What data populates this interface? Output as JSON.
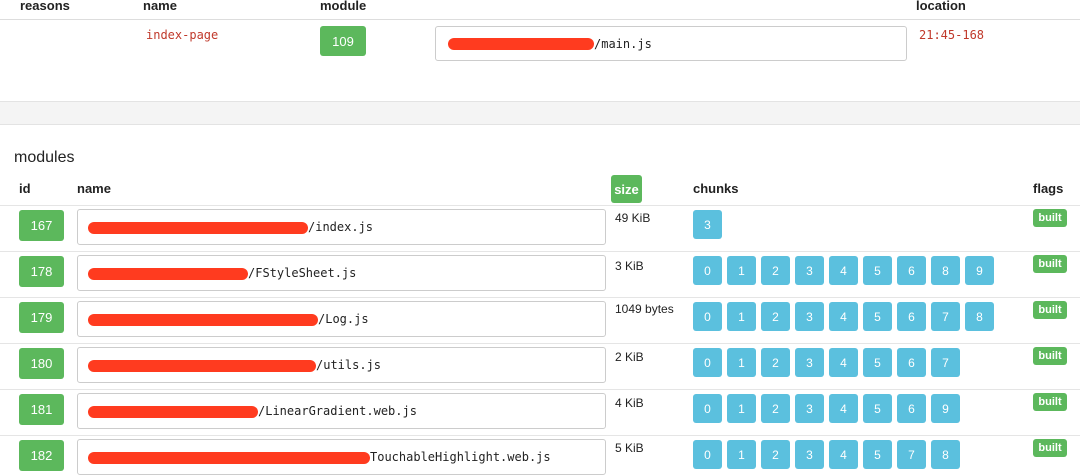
{
  "reasons_table": {
    "headers": {
      "reasons": "reasons",
      "name": "name",
      "module": "module",
      "location": "location"
    },
    "row": {
      "name": "index-page",
      "module_id": "109",
      "path": "/main.js",
      "location": "21:45-168"
    }
  },
  "modules": {
    "title": "modules",
    "headers": {
      "id": "id",
      "name": "name",
      "size": "size",
      "chunks": "chunks",
      "flags": "flags"
    },
    "rows": [
      {
        "id": "167",
        "path": "/index.js",
        "size": "49 KiB",
        "chunks": [
          "3"
        ],
        "flag": "built"
      },
      {
        "id": "178",
        "path": "/FStyleSheet.js",
        "size": "3 KiB",
        "chunks": [
          "0",
          "1",
          "2",
          "3",
          "4",
          "5",
          "6",
          "8",
          "9"
        ],
        "flag": "built"
      },
      {
        "id": "179",
        "path": "/Log.js",
        "size": "1049 bytes",
        "chunks": [
          "0",
          "1",
          "2",
          "3",
          "4",
          "5",
          "6",
          "7",
          "8"
        ],
        "flag": "built"
      },
      {
        "id": "180",
        "path": "/utils.js",
        "size": "2 KiB",
        "chunks": [
          "0",
          "1",
          "2",
          "3",
          "4",
          "5",
          "6",
          "7"
        ],
        "flag": "built"
      },
      {
        "id": "181",
        "path": "/LinearGradient.web.js",
        "size": "4 KiB",
        "chunks": [
          "0",
          "1",
          "2",
          "3",
          "4",
          "5",
          "6",
          "9"
        ],
        "flag": "built"
      },
      {
        "id": "182",
        "path": "TouchableHighlight.web.js",
        "size": "5 KiB",
        "chunks": [
          "0",
          "1",
          "2",
          "3",
          "4",
          "5",
          "7",
          "8"
        ],
        "flag": "built"
      }
    ]
  },
  "colors": {
    "green": "#5cb85c",
    "blue": "#5bc0de",
    "red": "#c0392b",
    "redaction": "#ff3b1f"
  }
}
